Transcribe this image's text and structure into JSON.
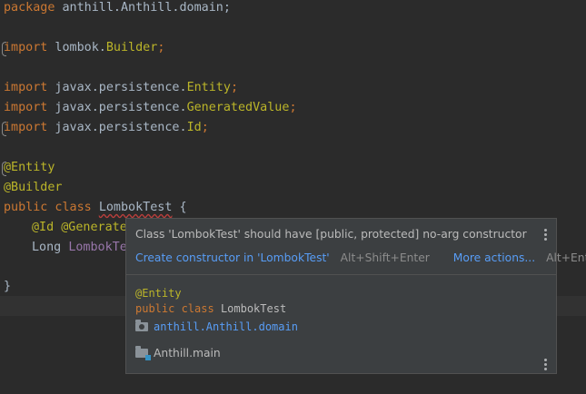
{
  "editor": {
    "lines": [
      {
        "parts": [
          "package",
          " anthill.Anthill.domain;"
        ]
      },
      {
        "parts": [
          "import",
          " lombok.",
          "Builder",
          ";"
        ]
      },
      {
        "parts": [
          "import",
          " javax.persistence.",
          "Entity",
          ";"
        ]
      },
      {
        "parts": [
          "import",
          " javax.persistence.",
          "GeneratedValue",
          ";"
        ]
      },
      {
        "parts": [
          "import",
          " javax.persistence.",
          "Id",
          ";"
        ]
      },
      {
        "parts": [
          "@Entity"
        ]
      },
      {
        "parts": [
          "@Builder"
        ]
      },
      {
        "parts": [
          "public class",
          " ",
          "LombokTest",
          " {"
        ]
      },
      {
        "parts": [
          "@Id @Generate"
        ]
      },
      {
        "parts": [
          "Long",
          " ",
          "LombokTe"
        ]
      },
      {
        "parts": [
          "}"
        ]
      }
    ]
  },
  "popup": {
    "title": "Class 'LombokTest' should have [public, protected] no-arg constructor",
    "action_label": "Create constructor in 'LombokTest'",
    "action_shortcut": "Alt+Shift+Enter",
    "more_actions_label": "More actions...",
    "more_actions_shortcut": "Alt+Enter",
    "code_annotation": "@Entity",
    "code_keywords": "public class",
    "code_classname": "LombokTest",
    "package_name": "anthill.Anthill.domain",
    "module_name": "Anthill.main"
  },
  "colors": {
    "background": "#2b2b2b",
    "keyword": "#cc7832",
    "annotation": "#bbb529",
    "link": "#589df6",
    "popup_bg": "#3c3f41"
  },
  "icons": [
    "more-vertical-icon",
    "package-folder-icon",
    "module-folder-icon"
  ]
}
